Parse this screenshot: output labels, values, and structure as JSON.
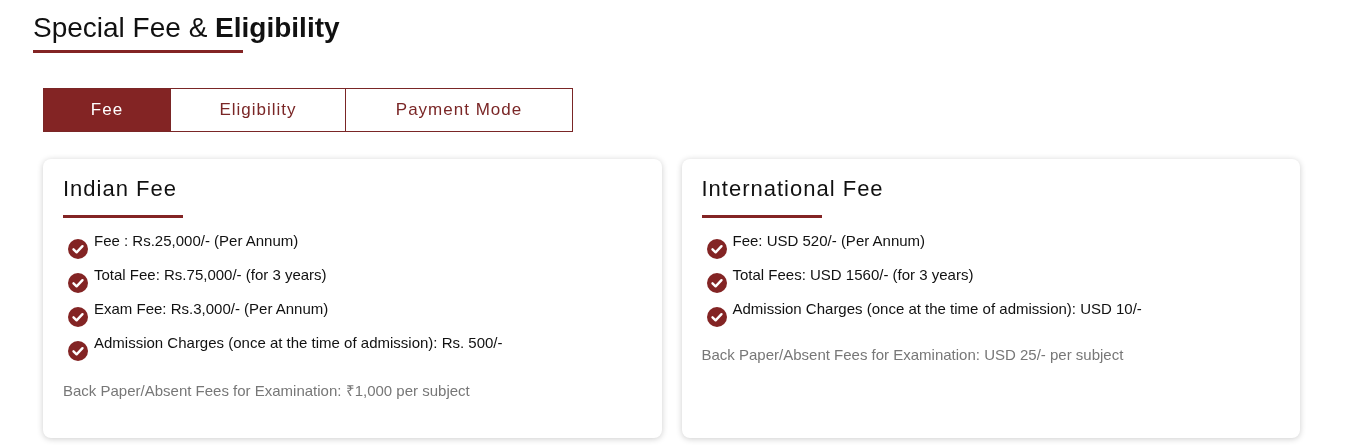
{
  "heading": "Special Fee & **Eligibility**",
  "tabs": [
    {
      "label": "Fee",
      "selected": true
    },
    {
      "label": "Eligibility",
      "selected": false
    },
    {
      "label": "Payment Mode",
      "selected": false
    }
  ],
  "cards": [
    {
      "title": "Indian Fee",
      "items": [
        "Fee : Rs.25,000/- (Per Annum)",
        "Total Fee: Rs.75,000/- (for 3 years)",
        "Exam Fee: Rs.3,000/- (Per Annum)",
        "Admission Charges (once at the time of admission): Rs. 500/-"
      ],
      "note": "Back Paper/Absent Fees for Examination: ₹1,000 per subject"
    },
    {
      "title": "International Fee",
      "items": [
        "Fee: USD 520/- (Per Annum)",
        "Total Fees: USD 1560/- (for 3 years)",
        "Admission Charges (once at the time of admission): USD 10/-"
      ],
      "note": "Back Paper/Absent Fees for Examination: USD 25/- per subject"
    }
  ]
}
